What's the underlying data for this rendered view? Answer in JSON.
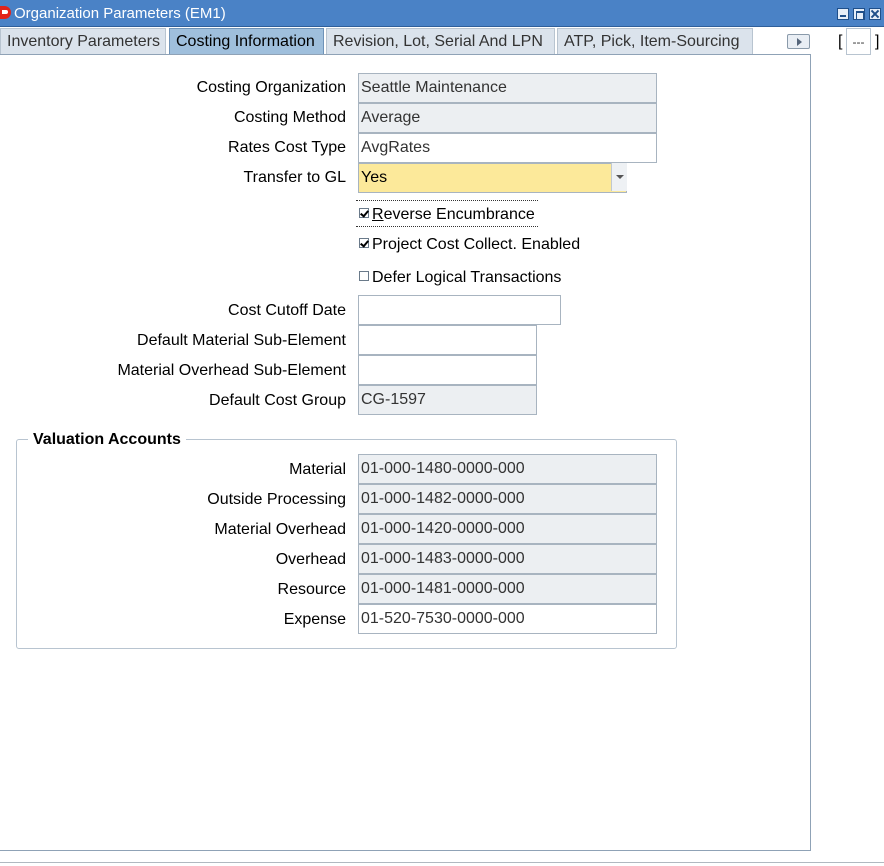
{
  "window": {
    "title": "Organization Parameters (EM1)"
  },
  "tabs": [
    {
      "label": "Inventory Parameters"
    },
    {
      "label": "Costing Information"
    },
    {
      "label": "Revision, Lot, Serial And LPN"
    },
    {
      "label": "ATP, Pick, Item-Sourcing"
    }
  ],
  "tab_tail": {
    "open_bracket": "[",
    "field_value": "---",
    "close_bracket": "]"
  },
  "form": {
    "costing_org": {
      "label": "Costing Organization",
      "value": "Seattle Maintenance"
    },
    "costing_method": {
      "label": "Costing Method",
      "value": "Average"
    },
    "rates_cost_type": {
      "label": "Rates Cost Type",
      "value": "AvgRates"
    },
    "transfer_to_gl": {
      "label": "Transfer to GL",
      "value": "Yes"
    },
    "reverse_encumbrance": {
      "label_first": "R",
      "label_rest": "everse Encumbrance",
      "checked": true
    },
    "project_cost_collect": {
      "label": "Project Cost Collect. Enabled",
      "checked": true
    },
    "defer_logical": {
      "label": "Defer Logical Transactions",
      "checked": false
    },
    "cost_cutoff_date": {
      "label": "Cost Cutoff Date",
      "value": ""
    },
    "default_material_sub": {
      "label": "Default Material Sub-Element",
      "value": ""
    },
    "material_overhead_sub": {
      "label": "Material Overhead Sub-Element",
      "value": ""
    },
    "default_cost_group": {
      "label": "Default Cost Group",
      "value": "CG-1597"
    }
  },
  "valuation": {
    "title": "Valuation Accounts",
    "material": {
      "label": "Material",
      "value": "01-000-1480-0000-000"
    },
    "outside_processing": {
      "label": "Outside Processing",
      "value": "01-000-1482-0000-000"
    },
    "material_overhead": {
      "label": "Material Overhead",
      "value": "01-000-1420-0000-000"
    },
    "overhead": {
      "label": "Overhead",
      "value": "01-000-1483-0000-000"
    },
    "resource": {
      "label": "Resource",
      "value": "01-000-1481-0000-000"
    },
    "expense": {
      "label": "Expense",
      "value": "01-520-7530-0000-000"
    }
  }
}
